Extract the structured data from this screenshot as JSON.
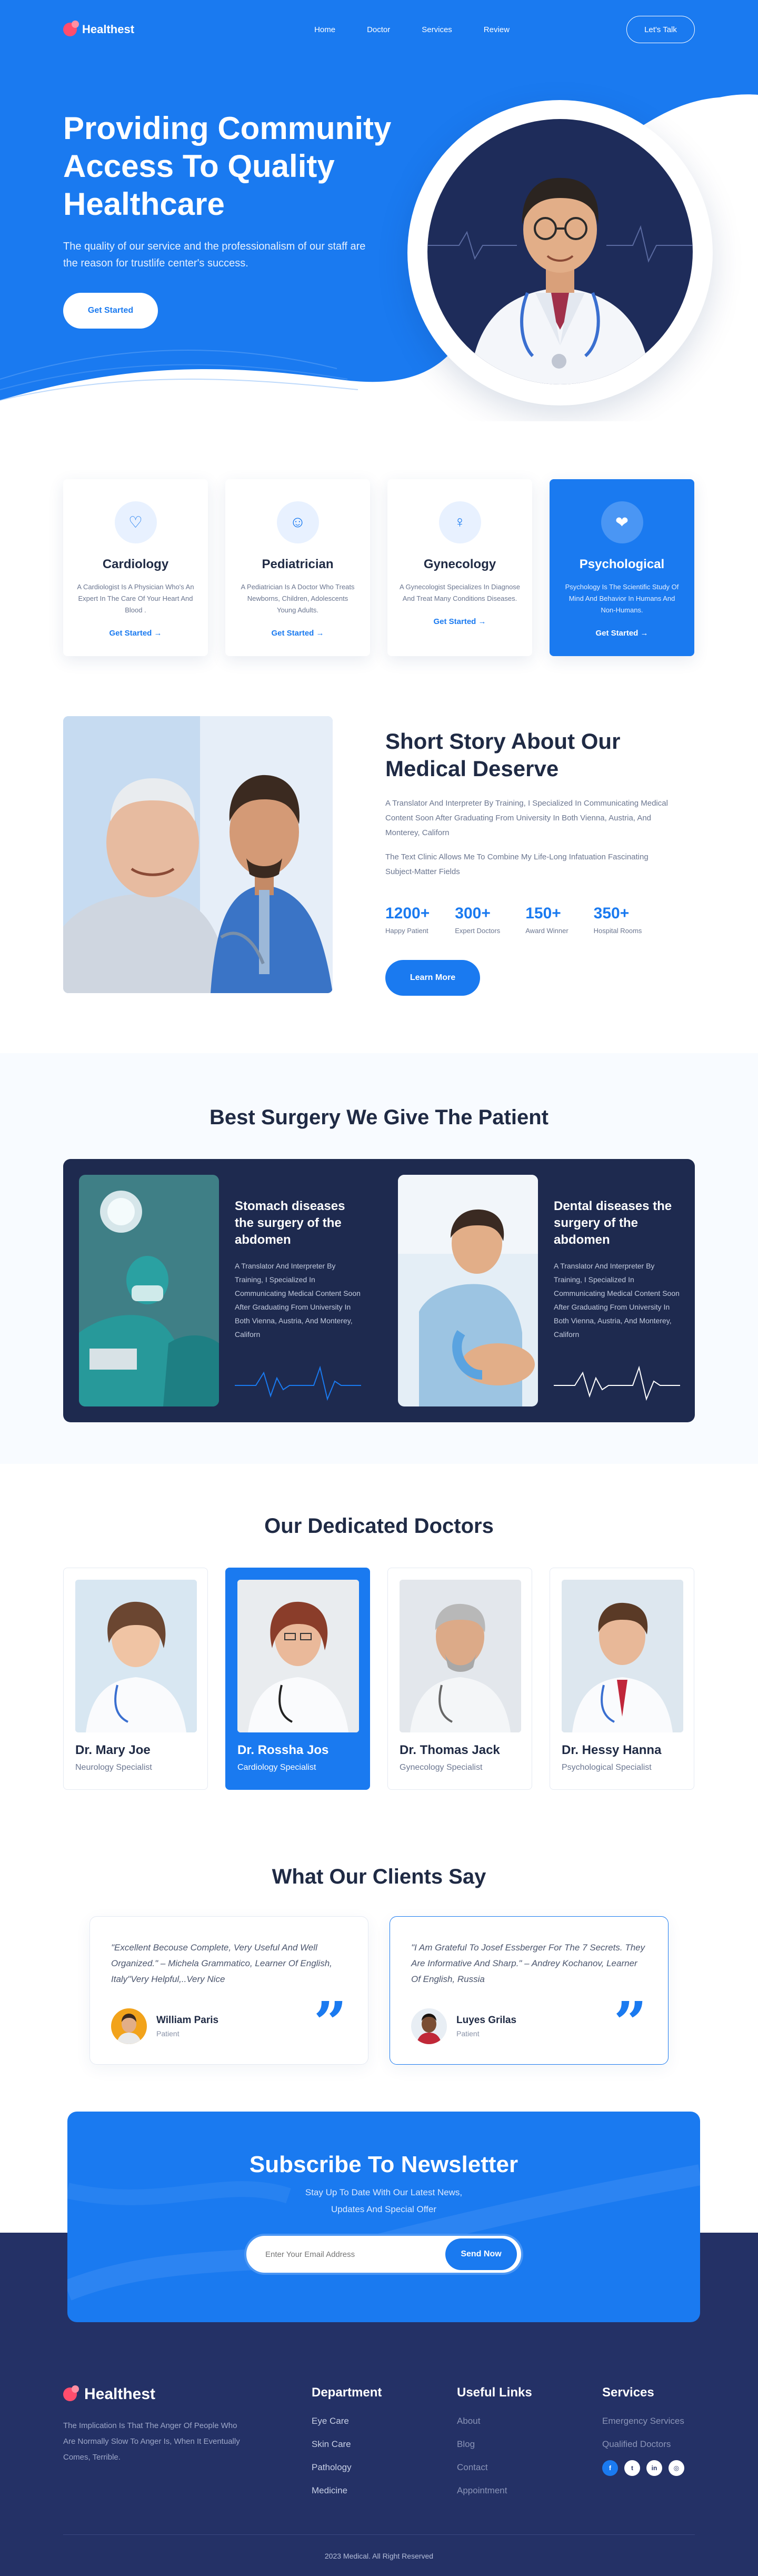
{
  "brand": {
    "name": "Healthest",
    "accent": "#1a7af0",
    "dark": "#1e2a4f",
    "logo_color": "#ff4d6d"
  },
  "nav": {
    "links": [
      "Home",
      "Doctor",
      "Services",
      "Review"
    ],
    "cta": "Let's Talk"
  },
  "hero": {
    "title": "Providing Community Access To Quality Healthcare",
    "subtitle": "The quality of our service and the professionalism of our staff are the reason for trustlife center's success.",
    "button": "Get Started"
  },
  "services": [
    {
      "icon": "heart-icon",
      "title": "Cardiology",
      "desc": "A Cardiologist Is A Physician Who's An Expert In The Care Of Your Heart And Blood .",
      "link": "Get Started"
    },
    {
      "icon": "baby-icon",
      "title": "Pediatrician",
      "desc": "A Pediatrician Is A Doctor Who Treats Newborns, Children, Adolescents Young Adults.",
      "link": "Get Started"
    },
    {
      "icon": "female-doctor-icon",
      "title": "Gynecology",
      "desc": "A Gynecologist Specializes In Diagnose And Treat Many Conditions Diseases.",
      "link": "Get Started"
    },
    {
      "icon": "brain-heart-icon",
      "title": "Psychological",
      "desc": "Psychology Is The Scientific Study Of Mind And Behavior In Humans And Non-Humans.",
      "link": "Get Started"
    }
  ],
  "story": {
    "title": "Short Story About Our Medical Deserve",
    "para1": "A Translator And Interpreter By Training, I Specialized In Communicating Medical Content Soon After Graduating From University In Both Vienna, Austria, And Monterey, Californ",
    "para2": "The Text Clinic Allows Me To Combine My Life-Long Infatuation Fascinating Subject-Matter Fields",
    "stats": [
      {
        "value": "1200+",
        "label": "Happy Patient"
      },
      {
        "value": "300+",
        "label": "Expert Doctors"
      },
      {
        "value": "150+",
        "label": "Award Winner"
      },
      {
        "value": "350+",
        "label": "Hospital Rooms"
      }
    ],
    "button": "Learn More"
  },
  "surgery": {
    "title": "Best Surgery We Give The Patient",
    "items": [
      {
        "title": "Stomach diseases the surgery of the abdomen",
        "text": "A Translator And Interpreter By Training, I Specialized In Communicating Medical Content Soon After Graduating From University In Both Vienna, Austria, And Monterey, Californ"
      },
      {
        "title": "Dental diseases the surgery of the abdomen",
        "text": "A Translator And Interpreter By Training, I Specialized In Communicating Medical Content Soon After Graduating From University In Both Vienna, Austria, And Monterey, Californ"
      }
    ]
  },
  "doctors": {
    "title": "Our Dedicated Doctors",
    "list": [
      {
        "name": "Dr. Mary Joe",
        "role": "Neurology Specialist"
      },
      {
        "name": "Dr. Rossha Jos",
        "role": "Cardiology Specialist"
      },
      {
        "name": "Dr. Thomas Jack",
        "role": "Gynecology Specialist"
      },
      {
        "name": "Dr. Hessy Hanna",
        "role": "Psychological Specialist"
      }
    ]
  },
  "testimonials": {
    "title": "What Our Clients Say",
    "list": [
      {
        "quote": "\"Excellent Becouse Complete, Very Useful And Well Organized.\" – Michela Grammatico, Learner Of English, Italy\"Very Helpful,..Very Nice",
        "name": "William Paris",
        "role": "Patient"
      },
      {
        "quote": "\"I Am Grateful To Josef Essberger For The 7 Secrets. They Are Informative And Sharp.\" – Andrey Kochanov, Learner Of English, Russia",
        "name": "Luyes Grilas",
        "role": "Patient"
      }
    ]
  },
  "newsletter": {
    "title": "Subscribe To Newsletter",
    "subtitle": "Stay Up To Date With Our Latest News, Updates And Special Offer",
    "placeholder": "Enter Your Email Address",
    "button": "Send Now"
  },
  "footer": {
    "brand": "Healthest",
    "desc": "The Implication Is That The Anger Of People Who Are Normally Slow To Anger Is, When It Eventually Comes, Terrible.",
    "department": {
      "title": "Department",
      "items": [
        "Eye Care",
        "Skin Care",
        "Pathology",
        "Medicine"
      ]
    },
    "links": {
      "title": "Useful Links",
      "items": [
        "About",
        "Blog",
        "Contact",
        "Appointment"
      ]
    },
    "services": {
      "title": "Services",
      "items": [
        "Emergency Services",
        "Qualified Doctors"
      ]
    },
    "socials": [
      "facebook-icon",
      "twitter-icon",
      "linkedin-icon",
      "instagram-icon"
    ],
    "copyright": "2023 Medical. All Right Reserved"
  }
}
